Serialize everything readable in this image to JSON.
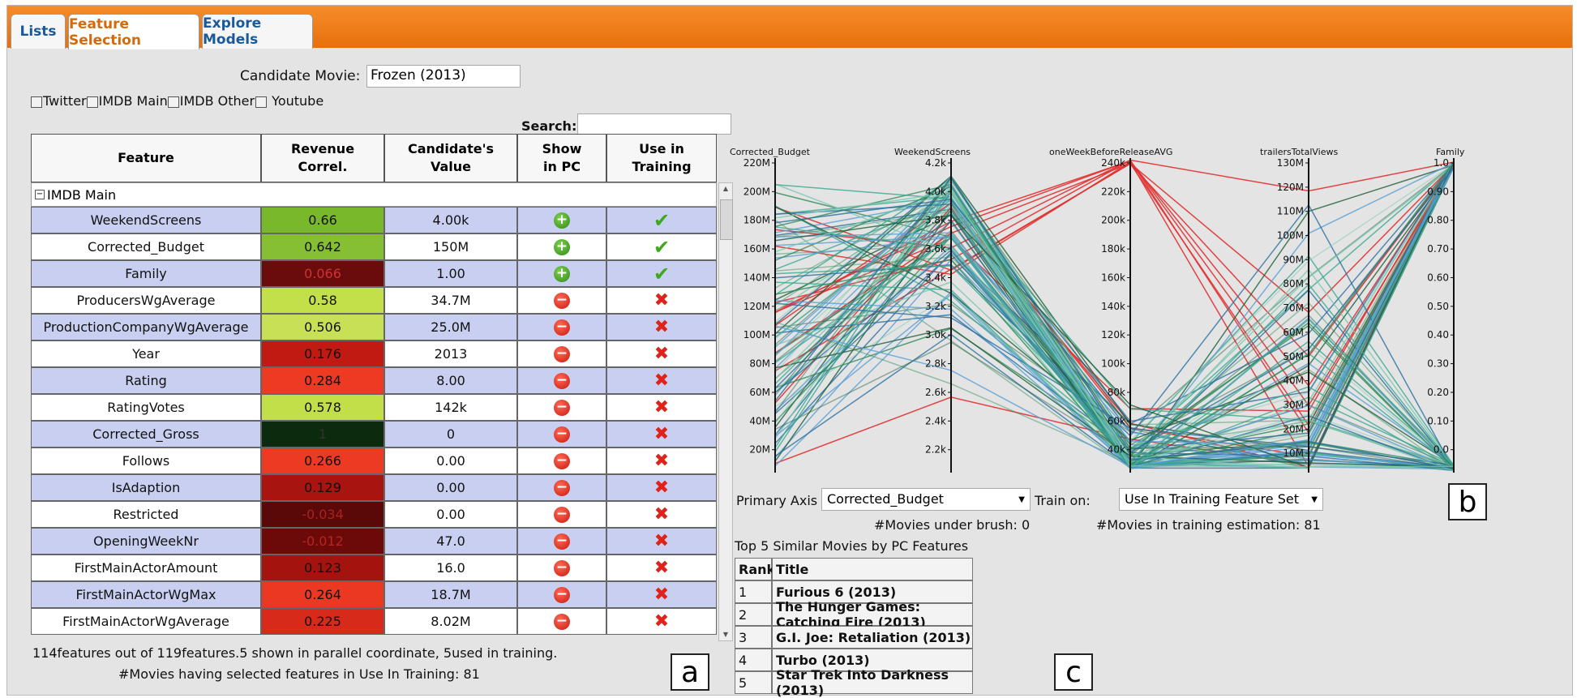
{
  "tabs": [
    {
      "label": "Lists",
      "active": false
    },
    {
      "label": "Feature Selection",
      "active": true
    },
    {
      "label": "Explore Models",
      "active": false
    }
  ],
  "candidate": {
    "label": "Candidate Movie:",
    "value": "Frozen (2013)"
  },
  "sources": [
    "Twitter",
    "IMDB Main",
    "IMDB Other",
    "Youtube"
  ],
  "search": {
    "label": "Search:",
    "value": ""
  },
  "table": {
    "headers": [
      "Feature",
      "Revenue Correl.",
      "Candidate's Value",
      "Show in PC",
      "Use in Training"
    ],
    "group": "IMDB Main",
    "rows": [
      {
        "feature": "WeekendScreens",
        "correl": "0.66",
        "value": "4.00k",
        "show": true,
        "use": true,
        "color": "#78b82a",
        "text": "#111"
      },
      {
        "feature": "Corrected_Budget",
        "correl": "0.642",
        "value": "150M",
        "show": true,
        "use": true,
        "color": "#86bf34",
        "text": "#111"
      },
      {
        "feature": "Family",
        "correl": "0.066",
        "value": "1.00",
        "show": true,
        "use": true,
        "color": "#6a0c0c",
        "text": "#c33"
      },
      {
        "feature": "ProducersWgAverage",
        "correl": "0.58",
        "value": "34.7M",
        "show": false,
        "use": false,
        "color": "#c3e04a",
        "text": "#111"
      },
      {
        "feature": "ProductionCompanyWgAverage",
        "correl": "0.506",
        "value": "25.0M",
        "show": false,
        "use": false,
        "color": "#c8e055",
        "text": "#111"
      },
      {
        "feature": "Year",
        "correl": "0.176",
        "value": "2013",
        "show": false,
        "use": false,
        "color": "#c11a12",
        "text": "#111"
      },
      {
        "feature": "Rating",
        "correl": "0.284",
        "value": "8.00",
        "show": false,
        "use": false,
        "color": "#ee3a22",
        "text": "#111"
      },
      {
        "feature": "RatingVotes",
        "correl": "0.578",
        "value": "142k",
        "show": false,
        "use": false,
        "color": "#c2df4a",
        "text": "#111"
      },
      {
        "feature": "Corrected_Gross",
        "correl": "1",
        "value": "0",
        "show": false,
        "use": false,
        "color": "#0b2a0e",
        "text": "#333"
      },
      {
        "feature": "Follows",
        "correl": "0.266",
        "value": "0.00",
        "show": false,
        "use": false,
        "color": "#ec3a23",
        "text": "#111"
      },
      {
        "feature": "IsAdaption",
        "correl": "0.129",
        "value": "0.00",
        "show": false,
        "use": false,
        "color": "#a8140f",
        "text": "#111"
      },
      {
        "feature": "Restricted",
        "correl": "-0.034",
        "value": "0.00",
        "show": false,
        "use": false,
        "color": "#5a0808",
        "text": "#a22"
      },
      {
        "feature": "OpeningWeekNr",
        "correl": "-0.012",
        "value": "47.0",
        "show": false,
        "use": false,
        "color": "#6c0a0a",
        "text": "#b22"
      },
      {
        "feature": "FirstMainActorAmount",
        "correl": "0.123",
        "value": "16.0",
        "show": false,
        "use": false,
        "color": "#a5130f",
        "text": "#111"
      },
      {
        "feature": "FirstMainActorWgMax",
        "correl": "0.264",
        "value": "18.7M",
        "show": false,
        "use": false,
        "color": "#ea3822",
        "text": "#111"
      },
      {
        "feature": "FirstMainActorWgAverage",
        "correl": "0.225",
        "value": "8.02M",
        "show": false,
        "use": false,
        "color": "#d82a1a",
        "text": "#111"
      }
    ]
  },
  "footer": {
    "line1": "114features out of 119features.5 shown in parallel coordinate, 5used in training.",
    "line2": "#Movies having selected features in Use In Training: 81"
  },
  "labels": {
    "a": "a",
    "b": "b",
    "c": "c"
  },
  "pc": {
    "axes": [
      "Corrected_Budget",
      "WeekendScreens",
      "oneWeekBeforeReleaseAVG",
      "trailersTotalViews",
      "Family"
    ],
    "ticks": [
      [
        "220M",
        "200M",
        "180M",
        "160M",
        "140M",
        "120M",
        "100M",
        "80M",
        "60M",
        "40M",
        "20M"
      ],
      [
        "4.2k",
        "4.0k",
        "3.8k",
        "3.6k",
        "3.4k",
        "3.2k",
        "3.0k",
        "2.8k",
        "2.6k",
        "2.4k",
        "2.2k"
      ],
      [
        "240k",
        "220k",
        "200k",
        "180k",
        "160k",
        "140k",
        "120k",
        "100k",
        "80k",
        "60k",
        "40k"
      ],
      [
        "130M",
        "120M",
        "110M",
        "100M",
        "90M",
        "80M",
        "70M",
        "60M",
        "50M",
        "40M",
        "30M",
        "20M",
        "10M"
      ],
      [
        "1.0",
        "0.90",
        "0.80",
        "0.70",
        "0.60",
        "0.50",
        "0.40",
        "0.30",
        "0.20",
        "0.10",
        "0.0"
      ]
    ]
  },
  "controls": {
    "primary_axis_label": "Primary Axis",
    "primary_axis_value": "Corrected_Budget",
    "train_on_label": "Train on:",
    "train_on_value": "Use In Training Feature Set",
    "brush_count": "#Movies under brush: 0",
    "training_estimation": "#Movies in training estimation: 81"
  },
  "similar": {
    "title": "Top 5 Similar Movies by PC Features",
    "headers": [
      "Rank",
      "Title"
    ],
    "rows": [
      {
        "rank": "1",
        "title": "Furious 6 (2013)"
      },
      {
        "rank": "2",
        "title": "The Hunger Games: Catching Fire (2013)"
      },
      {
        "rank": "3",
        "title": "G.I. Joe: Retaliation (2013)"
      },
      {
        "rank": "4",
        "title": "Turbo (2013)"
      },
      {
        "rank": "5",
        "title": "Star Trek Into Darkness (2013)"
      }
    ]
  },
  "colors": {
    "tabbar": "#f07f1c",
    "row_alt": "#c9cff0",
    "plus": "#3a9a1c",
    "minus": "#d8221a"
  }
}
